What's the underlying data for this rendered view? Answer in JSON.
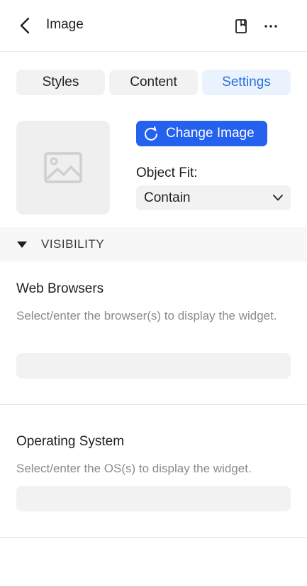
{
  "header": {
    "title": "Image",
    "back_icon": "chevron-left-icon",
    "bookmark_icon": "bookmark-icon",
    "more_icon": "more-horizontal-icon"
  },
  "tabs": [
    {
      "label": "Styles",
      "active": false
    },
    {
      "label": "Content",
      "active": false
    },
    {
      "label": "Settings",
      "active": true
    }
  ],
  "image": {
    "placeholder_icon": "image-placeholder-icon",
    "change_label": "Change Image",
    "change_icon": "refresh-icon",
    "object_fit_label": "Object Fit:",
    "object_fit_value": "Contain",
    "select_icon": "chevron-down-icon"
  },
  "visibility": {
    "section_title": "VISIBILITY",
    "toggle_icon": "caret-down-icon",
    "web_browsers": {
      "title": "Web Browsers",
      "description": "Select/enter the browser(s) to display the widget.",
      "value": ""
    },
    "operating_system": {
      "title": "Operating System",
      "description": "Select/enter the OS(s) to display the widget.",
      "value": ""
    }
  },
  "colors": {
    "accent": "#2461ee",
    "active_tab_bg": "#eaf3fd",
    "active_tab_text": "#2a6fe0",
    "muted_text": "#8b8b8b"
  }
}
